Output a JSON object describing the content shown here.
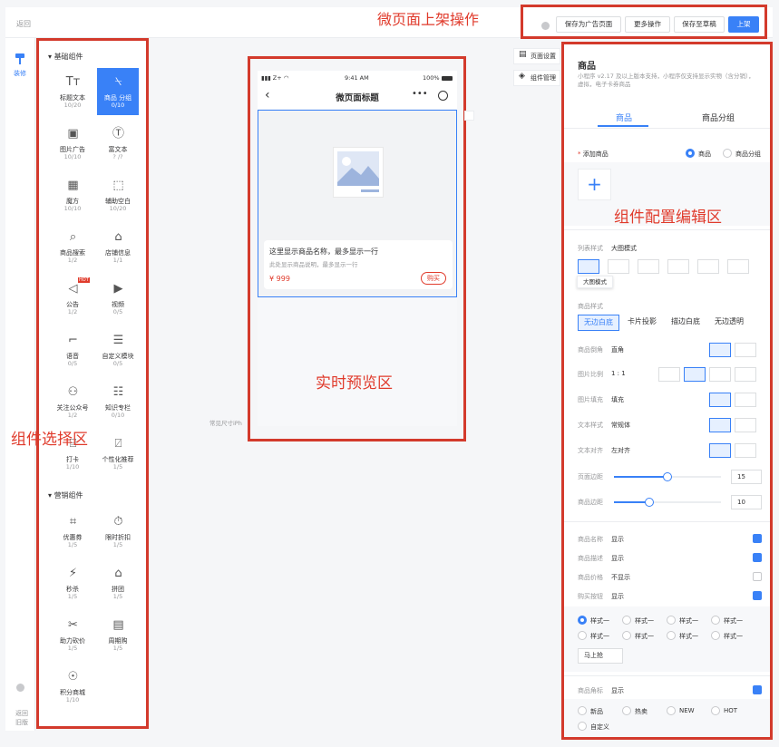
{
  "topbar": {
    "back": "返回",
    "buttons": [
      "保存为广告页面",
      "更多操作",
      "保存至草稿",
      "上架"
    ]
  },
  "annotations": {
    "publish": "微页面上架操作",
    "select": "组件选择区",
    "preview": "实时预览区",
    "config": "组件配置编辑区"
  },
  "rail": {
    "decorate": "装修",
    "old_version": "返回旧版"
  },
  "basic_section": "基础组件",
  "marketing_section": "营销组件",
  "basic_components": [
    {
      "name": "标题文本",
      "count": "10/20",
      "icon": "title-text-icon"
    },
    {
      "name": "商品 分组",
      "count": "0/10",
      "icon": "goods-group-icon",
      "active": true
    },
    {
      "name": "图片广告",
      "count": "10/10",
      "icon": "image-ad-icon"
    },
    {
      "name": "富文本",
      "count": "? /?",
      "icon": "rich-text-icon"
    },
    {
      "name": "魔方",
      "count": "10/10",
      "icon": "magic-cube-icon"
    },
    {
      "name": "辅助空白",
      "count": "10/20",
      "icon": "blank-space-icon"
    },
    {
      "name": "商品搜索",
      "count": "1/2",
      "icon": "search-icon"
    },
    {
      "name": "店铺信息",
      "count": "1/1",
      "icon": "store-icon"
    },
    {
      "name": "公告",
      "count": "1/2",
      "icon": "notice-icon",
      "badge": "HOT"
    },
    {
      "name": "视频",
      "count": "0/5",
      "icon": "video-icon"
    },
    {
      "name": "语音",
      "count": "0/5",
      "icon": "microphone-icon"
    },
    {
      "name": "自定义模块",
      "count": "0/5",
      "icon": "custom-module-icon"
    },
    {
      "name": "关注公众号",
      "count": "1/2",
      "icon": "chat-icon"
    },
    {
      "name": "知识专栏",
      "count": "0/10",
      "icon": "knowledge-icon"
    },
    {
      "name": "打卡",
      "count": "1/10",
      "icon": "book-icon"
    },
    {
      "name": "个性化推荐",
      "count": "1/5",
      "icon": "tshirt-icon"
    }
  ],
  "marketing_components": [
    {
      "name": "优惠券",
      "count": "1/5",
      "icon": "coupon-icon"
    },
    {
      "name": "限时折扣",
      "count": "1/5",
      "icon": "timer-icon"
    },
    {
      "name": "秒杀",
      "count": "1/5",
      "icon": "flash-sale-icon"
    },
    {
      "name": "拼团",
      "count": "1/5",
      "icon": "group-buy-icon"
    },
    {
      "name": "助力砍价",
      "count": "1/5",
      "icon": "bargain-icon"
    },
    {
      "name": "周期购",
      "count": "1/5",
      "icon": "calendar-icon"
    },
    {
      "name": "积分商城",
      "count": "1/10",
      "icon": "medal-icon"
    }
  ],
  "phone": {
    "carrier": "Z+",
    "time": "9:41 AM",
    "battery": "100%",
    "title": "微页面标题",
    "goods_name": "这里显示商品名称，最多显示一行",
    "goods_desc": "此处显示商品说明，最多显示一行",
    "price": "¥ 999",
    "buy": "购买"
  },
  "preview_side": {
    "page_settings": "页面设置",
    "component_manage": "组件管理",
    "common_size": "常见尺寸iPh"
  },
  "config": {
    "title": "商品",
    "desc": "小程序 v2.17 及以上版本支持，小程序仅支持显示实物（含分销），虚拟，电子卡券商品",
    "tabs": [
      "商品",
      "商品分组"
    ],
    "add_goods_label": "添加商品",
    "add_goods_required": "*",
    "add_radio": [
      "商品",
      "商品分组"
    ],
    "list_style_label": "列表样式",
    "list_style_value": "大图模式",
    "list_style_tooltip": "大图模式",
    "goods_style_label": "商品样式",
    "goods_styles": [
      "无边白底",
      "卡片投影",
      "描边白底",
      "无边透明"
    ],
    "rows": [
      {
        "label": "商品倒角",
        "value": "直角"
      },
      {
        "label": "图片比例",
        "value": "1 : 1"
      },
      {
        "label": "图片填充",
        "value": "填充"
      },
      {
        "label": "文本样式",
        "value": "常规体"
      },
      {
        "label": "文本对齐",
        "value": "左对齐"
      },
      {
        "label": "页面边距",
        "value": "15",
        "level": 15,
        "max": 30
      },
      {
        "label": "商品边距",
        "value": "10",
        "level": 10,
        "max": 30
      }
    ],
    "toggles": [
      {
        "label": "商品名称",
        "value": "显示",
        "checked": true
      },
      {
        "label": "商品描述",
        "value": "显示",
        "checked": true
      },
      {
        "label": "商品价格",
        "value": "不显示",
        "checked": false
      },
      {
        "label": "购买按钮",
        "value": "显示",
        "checked": true
      }
    ],
    "button_styles": [
      "样式一",
      "样式一",
      "样式一",
      "样式一",
      "样式一",
      "样式一",
      "样式一",
      "样式一"
    ],
    "button_text": "马上抢",
    "corner_label": "商品角标",
    "corner_value": "显示",
    "corner_options": [
      "新品",
      "热卖",
      "NEW",
      "HOT",
      "自定义"
    ],
    "accent": "#3981f7"
  }
}
